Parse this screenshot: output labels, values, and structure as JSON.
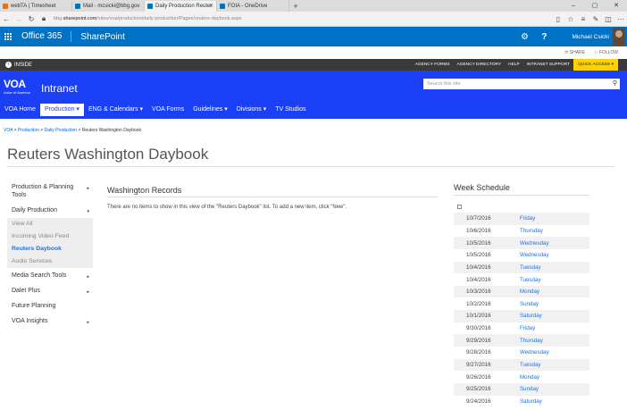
{
  "browser": {
    "tabs": [
      {
        "label": "webTA | Timesheet",
        "active": false,
        "fav_color": "#e8740c"
      },
      {
        "label": "Mail - mcsicki@bbg.gov",
        "active": false,
        "fav_color": "#0072c6"
      },
      {
        "label": "Daily Production Reuter",
        "active": true,
        "fav_color": "#0072c6"
      },
      {
        "label": "FOIA - OneDrive",
        "active": false,
        "fav_color": "#0072c6"
      }
    ],
    "url_prefix": "bbg.",
    "url_domain": "sharepoint.com",
    "url_rest": "/sites/voa/production/daily-production/Pages/reuters-daybook.aspx"
  },
  "suite": {
    "brand": "Office 365",
    "app": "SharePoint",
    "user": "Michael Csicki",
    "share": "SHARE",
    "follow": "FOLLOW"
  },
  "inside": {
    "label": "INSIDE",
    "links": [
      "AGENCY FORMS",
      "AGENCY DIRECTORY",
      "HELP",
      "INTRANET SUPPORT"
    ],
    "quick_access": "QUICK ACCESS ▾"
  },
  "header": {
    "logo_text": "VOA",
    "logo_sub": "Voice of America",
    "site_name": "Intranet",
    "search_placeholder": "Search this site"
  },
  "topnav": [
    {
      "label": "VOA Home",
      "active": false
    },
    {
      "label": "Production ▾",
      "active": true
    },
    {
      "label": "ENG & Calendars ▾",
      "active": false
    },
    {
      "label": "VOA Forms",
      "active": false
    },
    {
      "label": "Guidelines ▾",
      "active": false
    },
    {
      "label": "Divisions ▾",
      "active": false
    },
    {
      "label": "TV Studios",
      "active": false
    }
  ],
  "breadcrumb": {
    "links": [
      "VOA",
      "Production",
      "Daily Production"
    ],
    "current": "Reuters Washington Daybook"
  },
  "page_title": "Reuters Washington Daybook",
  "leftnav": {
    "items_top": [
      {
        "label": "Production & Planning Tools",
        "arrow": "▸"
      },
      {
        "label": "Daily Production",
        "arrow": "▾"
      }
    ],
    "sub_items": [
      {
        "label": "View All",
        "selected": false
      },
      {
        "label": "Incoming Video Feed",
        "selected": false
      },
      {
        "label": "Reuters Daybook",
        "selected": true
      },
      {
        "label": "Audio Services",
        "selected": false
      }
    ],
    "items_bottom": [
      {
        "label": "Media Search Tools",
        "arrow": "▸"
      },
      {
        "label": "Dalet Plus",
        "arrow": "▸"
      },
      {
        "label": "Future Planning",
        "arrow": ""
      },
      {
        "label": "VOA Insights",
        "arrow": "▸"
      }
    ]
  },
  "main": {
    "title": "Washington Records",
    "empty_message": "There are no items to show in this view of the \"Reuters Daybook\" list. To add a new item, click \"New\"."
  },
  "week_schedule": {
    "title": "Week Schedule",
    "rows": [
      {
        "date": "10/7/2016",
        "day": "Friday"
      },
      {
        "date": "10/6/2016",
        "day": "Thursday"
      },
      {
        "date": "10/5/2016",
        "day": "Wednesday"
      },
      {
        "date": "10/5/2016",
        "day": "Wednesday"
      },
      {
        "date": "10/4/2016",
        "day": "Tuesday"
      },
      {
        "date": "10/4/2016",
        "day": "Tuesday"
      },
      {
        "date": "10/3/2016",
        "day": "Monday"
      },
      {
        "date": "10/2/2016",
        "day": "Sunday"
      },
      {
        "date": "10/1/2016",
        "day": "Saturday"
      },
      {
        "date": "9/30/2016",
        "day": "Friday"
      },
      {
        "date": "9/29/2016",
        "day": "Thursday"
      },
      {
        "date": "9/28/2016",
        "day": "Wednesday"
      },
      {
        "date": "9/27/2016",
        "day": "Tuesday"
      },
      {
        "date": "9/26/2016",
        "day": "Monday"
      },
      {
        "date": "9/25/2016",
        "day": "Sunday"
      },
      {
        "date": "9/24/2016",
        "day": "Saturday"
      }
    ]
  },
  "colors": {
    "o365_blue": "#0072c6",
    "intranet_blue": "#1a3ff5",
    "link_blue": "#1a73e8",
    "quick_access_yellow": "#ffd200"
  }
}
